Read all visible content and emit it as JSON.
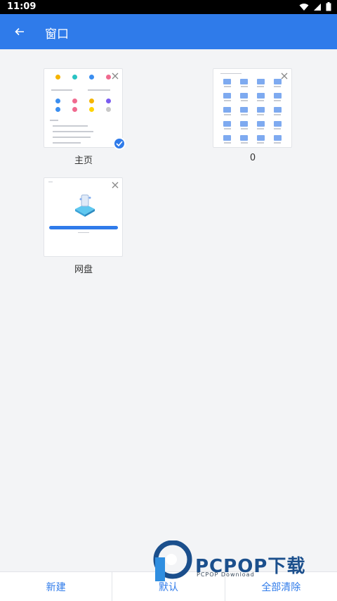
{
  "status": {
    "time": "11:09"
  },
  "app_bar": {
    "title": "窗口",
    "accent": "#2f7bea"
  },
  "windows": [
    {
      "label": "主页",
      "selected": true,
      "thumb": "home"
    },
    {
      "label": "0",
      "selected": false,
      "thumb": "folders"
    },
    {
      "label": "网盘",
      "selected": false,
      "thumb": "cloud"
    }
  ],
  "bottom": {
    "new_label": "新建",
    "default_label": "默认",
    "clear_label": "全部清除"
  },
  "watermark": {
    "brand": "PCPOP下载",
    "sub": "PCPOP Download"
  }
}
